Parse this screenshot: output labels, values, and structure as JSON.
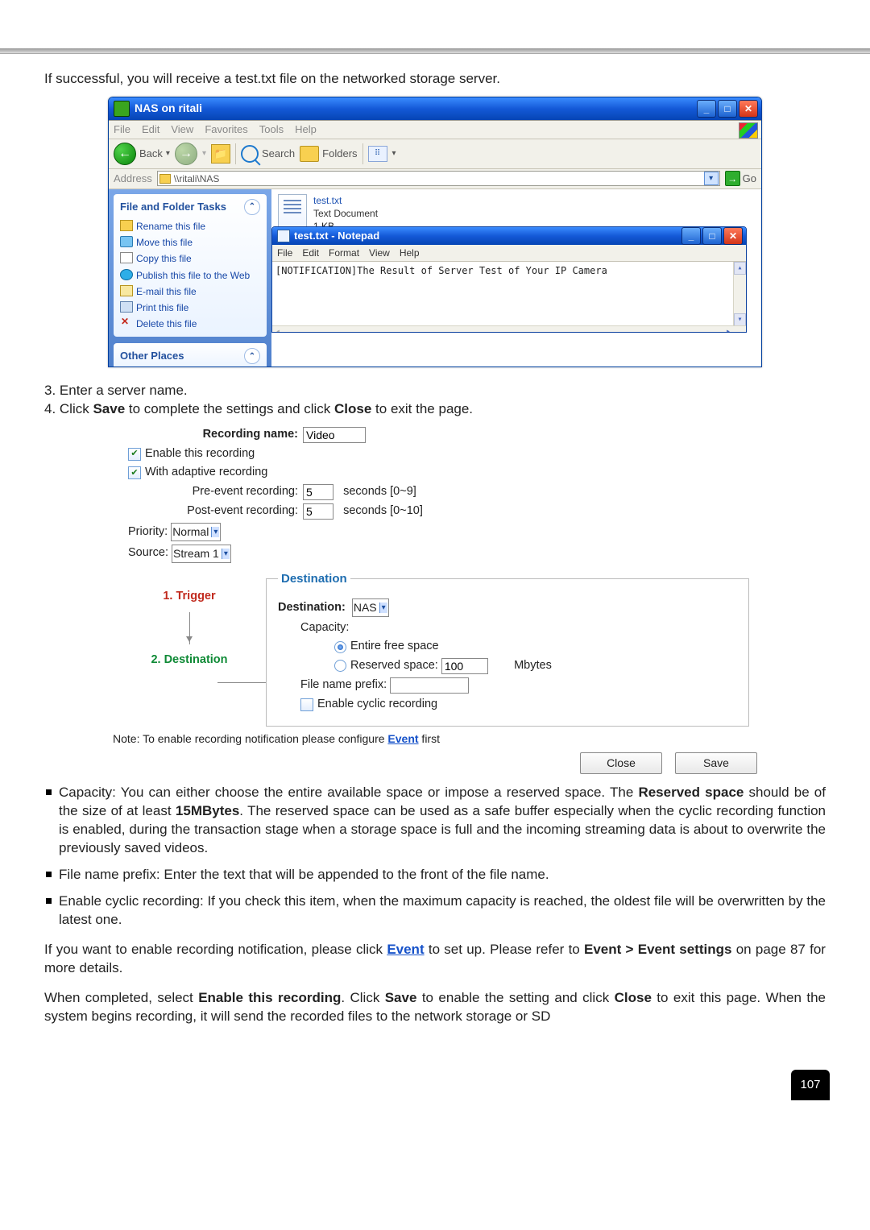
{
  "intro": "If successful, you will receive a test.txt file on the networked storage server.",
  "explorer": {
    "title": "NAS on ritali",
    "menu": [
      "File",
      "Edit",
      "View",
      "Favorites",
      "Tools",
      "Help"
    ],
    "toolbar": {
      "back": "Back",
      "search": "Search",
      "folders": "Folders"
    },
    "address_label": "Address",
    "address_value": "\\\\ritali\\NAS",
    "go": "Go",
    "panels": {
      "tasks_title": "File and Folder Tasks",
      "tasks": [
        "Rename this file",
        "Move this file",
        "Copy this file",
        "Publish this file to the Web",
        "E-mail this file",
        "Print this file",
        "Delete this file"
      ],
      "other_title": "Other Places"
    },
    "file": {
      "name": "test.txt",
      "type": "Text Document",
      "size": "1 KB"
    },
    "notepad": {
      "title": "test.txt - Notepad",
      "menu": [
        "File",
        "Edit",
        "Format",
        "View",
        "Help"
      ],
      "content": "[NOTIFICATION]The Result of Server Test of Your IP Camera"
    }
  },
  "steps": {
    "s3": "3. Enter a server name.",
    "s4_a": "4. Click ",
    "s4_b": "Save",
    "s4_c": " to complete the settings and click ",
    "s4_d": "Close",
    "s4_e": " to exit the page."
  },
  "recording": {
    "name_label": "Recording name:",
    "name_value": "Video",
    "enable": "Enable this recording",
    "adaptive": "With adaptive recording",
    "pre_label": "Pre-event recording:",
    "pre_value": "5",
    "pre_hint": "seconds [0~9]",
    "post_label": "Post-event recording:",
    "post_value": "5",
    "post_hint": "seconds [0~10]",
    "priority_label": "Priority:",
    "priority_value": "Normal",
    "source_label": "Source:",
    "source_value": "Stream 1",
    "flow1": "1.  Trigger",
    "flow2": "2.  Destination",
    "dest_legend": "Destination",
    "dest_label": "Destination:",
    "dest_value": "NAS",
    "capacity_label": "Capacity:",
    "cap_opt1": "Entire free space",
    "cap_opt2": "Reserved space:",
    "cap_val": "100",
    "cap_unit": "Mbytes",
    "prefix_label": "File name prefix:",
    "cyclic": "Enable cyclic recording",
    "note_a": "Note: To enable recording notification please configure ",
    "note_link": "Event",
    "note_b": " first",
    "close": "Close",
    "save": "Save"
  },
  "bullets": {
    "cap_a": "Capacity: You can either choose the entire available space or impose a reserved space. The ",
    "cap_b": "Reserved space",
    "cap_c": " should be of the size of at least ",
    "cap_d": "15MBytes",
    "cap_e": ". The reserved space can be used as a safe buffer especially when the cyclic recording function is enabled, during the transaction stage when a storage space is full and the incoming streaming data is about to overwrite the previously saved videos.",
    "fnp": "File name prefix: Enter the text that will be appended to the front of the file name.",
    "cyc": "Enable cyclic recording: If you check this item, when the maximum capacity is reached, the oldest file will be overwritten by the latest one."
  },
  "para1_a": "If you want to enable recording notification, please click ",
  "para1_link": "Event",
  "para1_b": " to set up. Please refer to ",
  "para1_c": "Event > Event settings",
  "para1_d": " on page 87 for more details.",
  "para2_a": "When completed, select ",
  "para2_b": "Enable this recording",
  "para2_c": ". Click ",
  "para2_d": "Save",
  "para2_e": " to enable the setting and click ",
  "para2_f": "Close",
  "para2_g": " to exit this page. When the system begins recording, it will send the recorded files to the network storage or SD",
  "page_number": "107"
}
